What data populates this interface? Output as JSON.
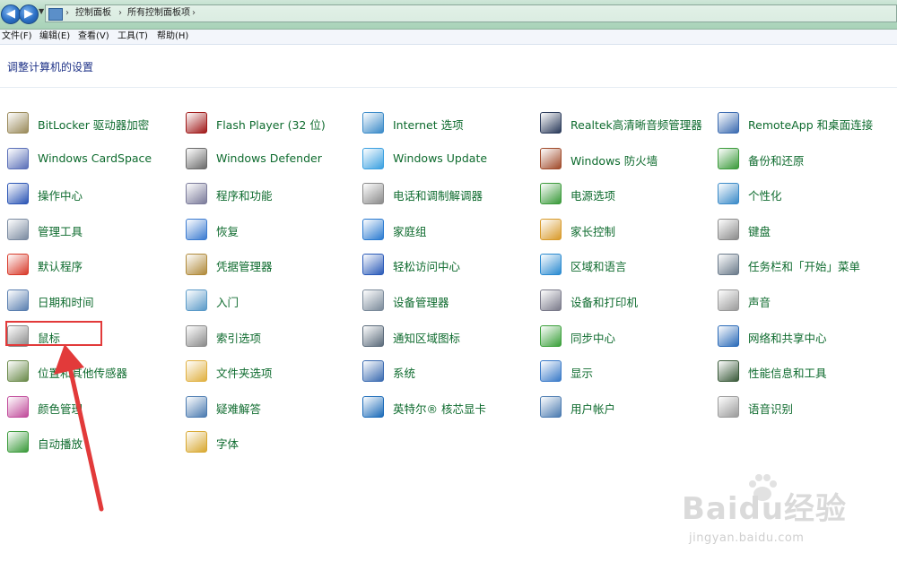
{
  "address": {
    "crumbs": [
      "控制面板",
      "所有控制面板项"
    ]
  },
  "menu": [
    "文件(F)",
    "编辑(E)",
    "查看(V)",
    "工具(T)",
    "帮助(H)"
  ],
  "heading": "调整计算机的设置",
  "columns": [
    [
      {
        "label": "BitLocker 驱动器加密",
        "icon": "bitlocker-icon",
        "color": "#9a8a5a"
      },
      {
        "label": "Windows CardSpace",
        "icon": "cardspace-icon",
        "color": "#5a6fb8"
      },
      {
        "label": "操作中心",
        "icon": "flag-icon",
        "color": "#2b55b5"
      },
      {
        "label": "管理工具",
        "icon": "admin-tools-icon",
        "color": "#7a8aa0"
      },
      {
        "label": "默认程序",
        "icon": "default-programs-icon",
        "color": "#d83a2a"
      },
      {
        "label": "日期和时间",
        "icon": "clock-icon",
        "color": "#5a7fb0"
      },
      {
        "label": "鼠标",
        "icon": "mouse-icon",
        "color": "#8a8a8a"
      },
      {
        "label": "位置和其他传感器",
        "icon": "sensor-icon",
        "color": "#6a8a4a"
      },
      {
        "label": "颜色管理",
        "icon": "color-management-icon",
        "color": "#c04a9a"
      },
      {
        "label": "自动播放",
        "icon": "autoplay-icon",
        "color": "#3a9a3a"
      }
    ],
    [
      {
        "label": "Flash Player (32 位)",
        "icon": "flash-icon",
        "color": "#a01818"
      },
      {
        "label": "Windows Defender",
        "icon": "defender-icon",
        "color": "#6a6a6a"
      },
      {
        "label": "程序和功能",
        "icon": "programs-icon",
        "color": "#7a7a9a"
      },
      {
        "label": "恢复",
        "icon": "recovery-icon",
        "color": "#3a7ad0"
      },
      {
        "label": "凭据管理器",
        "icon": "credential-icon",
        "color": "#b08a3a"
      },
      {
        "label": "入门",
        "icon": "getting-started-icon",
        "color": "#5a9ac8"
      },
      {
        "label": "索引选项",
        "icon": "index-icon",
        "color": "#8a8a8a"
      },
      {
        "label": "文件夹选项",
        "icon": "folder-icon",
        "color": "#e0b040"
      },
      {
        "label": "疑难解答",
        "icon": "troubleshoot-icon",
        "color": "#4a7ab0"
      },
      {
        "label": "字体",
        "icon": "fonts-icon",
        "color": "#d8a830"
      }
    ],
    [
      {
        "label": "Internet 选项",
        "icon": "internet-icon",
        "color": "#3a8ac8"
      },
      {
        "label": "Windows Update",
        "icon": "windows-update-icon",
        "color": "#3aa0e0"
      },
      {
        "label": "电话和调制解调器",
        "icon": "phone-icon",
        "color": "#8a8a8a"
      },
      {
        "label": "家庭组",
        "icon": "homegroup-icon",
        "color": "#2a7ad0"
      },
      {
        "label": "轻松访问中心",
        "icon": "ease-of-access-icon",
        "color": "#2a5ab8"
      },
      {
        "label": "设备管理器",
        "icon": "device-manager-icon",
        "color": "#7a8a9a"
      },
      {
        "label": "通知区域图标",
        "icon": "notification-icon",
        "color": "#5a6a7a"
      },
      {
        "label": "系统",
        "icon": "system-icon",
        "color": "#3a6ab0"
      },
      {
        "label": "英特尔® 核芯显卡",
        "icon": "intel-graphics-icon",
        "color": "#1a6ab8"
      }
    ],
    [
      {
        "label": "Realtek高清晰音频管理器",
        "icon": "realtek-icon",
        "color": "#2a3a5a"
      },
      {
        "label": "Windows 防火墙",
        "icon": "firewall-icon",
        "color": "#a04a2a"
      },
      {
        "label": "电源选项",
        "icon": "power-icon",
        "color": "#3a9a3a"
      },
      {
        "label": "家长控制",
        "icon": "parental-controls-icon",
        "color": "#d89a2a"
      },
      {
        "label": "区域和语言",
        "icon": "globe-icon",
        "color": "#2a8ad0"
      },
      {
        "label": "设备和打印机",
        "icon": "printer-icon",
        "color": "#7a7a8a"
      },
      {
        "label": "同步中心",
        "icon": "sync-icon",
        "color": "#3aa03a"
      },
      {
        "label": "显示",
        "icon": "display-icon",
        "color": "#3a7ac8"
      },
      {
        "label": "用户帐户",
        "icon": "user-accounts-icon",
        "color": "#4a7ab0"
      }
    ],
    [
      {
        "label": "RemoteApp 和桌面连接",
        "icon": "remoteapp-icon",
        "color": "#3a6ab0"
      },
      {
        "label": "备份和还原",
        "icon": "backup-icon",
        "color": "#3a9a3a"
      },
      {
        "label": "个性化",
        "icon": "personalization-icon",
        "color": "#3a8ac8"
      },
      {
        "label": "键盘",
        "icon": "keyboard-icon",
        "color": "#8a8a8a"
      },
      {
        "label": "任务栏和「开始」菜单",
        "icon": "taskbar-icon",
        "color": "#6a7a8a"
      },
      {
        "label": "声音",
        "icon": "sound-icon",
        "color": "#9a9a9a"
      },
      {
        "label": "网络和共享中心",
        "icon": "network-icon",
        "color": "#2a6ab8"
      },
      {
        "label": "性能信息和工具",
        "icon": "performance-icon",
        "color": "#3a5a3a"
      },
      {
        "label": "语音识别",
        "icon": "microphone-icon",
        "color": "#9a9a9a"
      }
    ]
  ],
  "watermark": {
    "main": "Baidu经验",
    "sub": "jingyan.baidu.com"
  }
}
